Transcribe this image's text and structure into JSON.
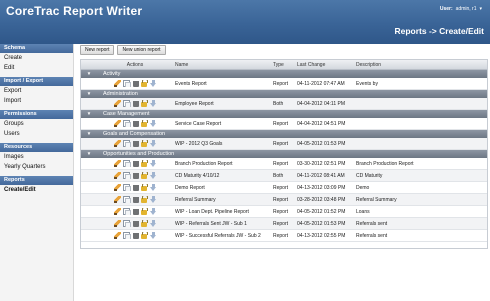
{
  "header": {
    "app_title": "CoreTrac Report Writer",
    "user_label": "User:",
    "user_name": "admin, r1",
    "breadcrumb": "Reports -> Create/Edit"
  },
  "sidebar": {
    "sections": [
      {
        "title": "Schema",
        "items": [
          "Create",
          "Edit"
        ]
      },
      {
        "title": "Import / Export",
        "items": [
          "Export",
          "Import"
        ]
      },
      {
        "title": "Permissions",
        "items": [
          "Groups",
          "Users"
        ]
      },
      {
        "title": "Resources",
        "items": [
          "Images",
          "Yearly Quarters"
        ]
      },
      {
        "title": "Reports",
        "items": [
          "Create/Edit"
        ]
      }
    ]
  },
  "toolbar": {
    "new_report": "New report",
    "new_union_report": "New union report"
  },
  "grid": {
    "columns": {
      "actions": "Actions",
      "name": "Name",
      "type": "Type",
      "last_change": "Last Change",
      "description": "Description"
    },
    "groups": [
      {
        "name": "Activity",
        "rows": [
          {
            "name": "Events Report",
            "type": "Report",
            "last_change": "04-11-2012 07:47 AM",
            "description": "Events by"
          }
        ]
      },
      {
        "name": "Administration",
        "rows": [
          {
            "name": "Employee Report",
            "type": "Both",
            "last_change": "04-04-2012 04:11 PM",
            "description": ""
          }
        ]
      },
      {
        "name": "Case Management",
        "rows": [
          {
            "name": "Service Case Report",
            "type": "Report",
            "last_change": "04-04-2012 04:51 PM",
            "description": ""
          }
        ]
      },
      {
        "name": "Goals and Compensation",
        "rows": [
          {
            "name": "WIP - 2012 Q3 Goals",
            "type": "Report",
            "last_change": "04-05-2012 01:53 PM",
            "description": ""
          }
        ]
      },
      {
        "name": "Opportunities and Production",
        "rows": [
          {
            "name": "Branch Production Report",
            "type": "Report",
            "last_change": "03-30-2012 02:51 PM",
            "description": "Branch Production Report"
          },
          {
            "name": "CD Maturity 4/10/12",
            "type": "Both",
            "last_change": "04-11-2012 08:41 AM",
            "description": "CD Maturity"
          },
          {
            "name": "Demo Report",
            "type": "Report",
            "last_change": "04-13-2012 03:09 PM",
            "description": "Demo"
          },
          {
            "name": "Referral Summary",
            "type": "Report",
            "last_change": "03-28-2012 03:48 PM",
            "description": "Referral Summary"
          },
          {
            "name": "WIP - Loan Dept. Pipeline Report",
            "type": "Report",
            "last_change": "04-05-2012 01:52 PM",
            "description": "Loans"
          },
          {
            "name": "WIP - Referrals Sent JW - Sub 1",
            "type": "Report",
            "last_change": "04-05-2012 01:53 PM",
            "description": "Referrals sent"
          },
          {
            "name": "WIP - Successful Referrals JW - Sub 2",
            "type": "Report",
            "last_change": "04-13-2012 02:55 PM",
            "description": "Referrals sent"
          }
        ]
      }
    ]
  },
  "icons": [
    "pencil-edit-icon",
    "copy-icon",
    "trash-icon",
    "lock-icon",
    "download-arrow-icon"
  ],
  "colors": {
    "header_blue": "#3a6497",
    "group_header": "#7a8390",
    "sidebar_section": "#4a70a2"
  }
}
